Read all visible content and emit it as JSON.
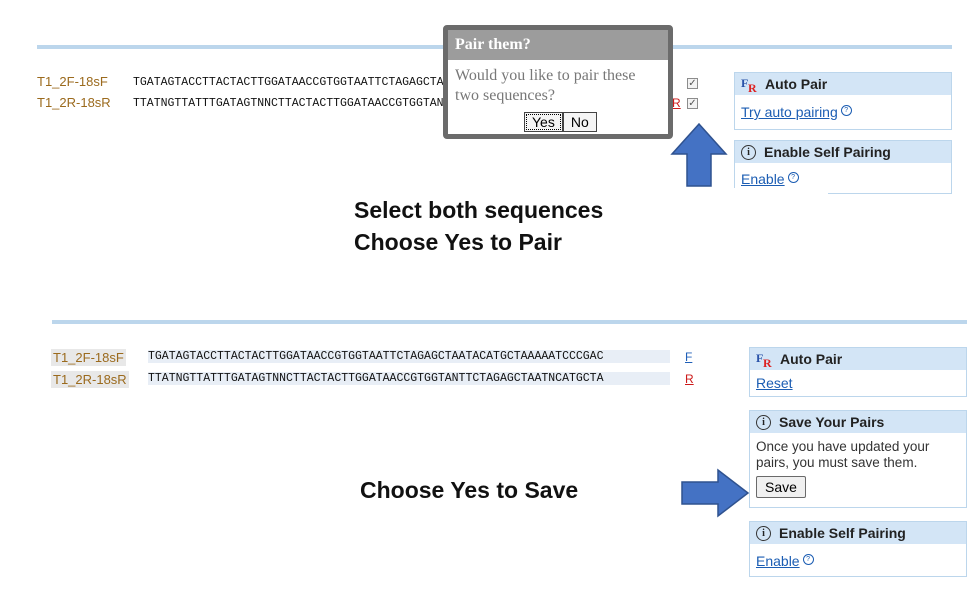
{
  "top": {
    "sequences": [
      {
        "name": "T1_2F-18sF",
        "seq": "TGATAGTACCTTACTACTTGGATAACCGTGGTAATTCTAGAGCTAATACATGCTAAAAATCCCGAC"
      },
      {
        "name": "T1_2R-18sR",
        "seq": "TTATNGTTATTTGATAGTNNCTTACTACTTGGATAACCGTGGTANTTCTAGAGCTAATNCATGCTA"
      }
    ],
    "reverse_marker": "R",
    "dialog": {
      "title": "Pair them?",
      "message": "Would you like to pair these two sequences?",
      "yes": "Yes",
      "no": "No"
    },
    "auto_pair": {
      "title": "Auto Pair",
      "link": "Try auto pairing"
    },
    "self_pairing": {
      "title": "Enable Self Pairing",
      "link": "Enable"
    },
    "caption_line1": "Select both sequences",
    "caption_line2": "Choose Yes to Pair"
  },
  "bottom": {
    "sequences": [
      {
        "name": "T1_2F-18sF",
        "seq": "TGATAGTACCTTACTACTTGGATAACCGTGGTAATTCTAGAGCTAATACATGCTAAAAATCCCGAC",
        "marker": "F"
      },
      {
        "name": "T1_2R-18sR",
        "seq": "TTATNGTTATTTGATAGTNNCTTACTACTTGGATAACCGTGGTANTTCTAGAGCTAATNCATGCTA",
        "marker": "R"
      }
    ],
    "auto_pair": {
      "title": "Auto Pair",
      "link": "Reset"
    },
    "save_pairs": {
      "title": "Save Your Pairs",
      "text": "Once you have updated your pairs, you must save them.",
      "button": "Save"
    },
    "self_pairing": {
      "title": "Enable Self Pairing",
      "link": "Enable"
    },
    "caption": "Choose Yes to Save"
  },
  "colors": {
    "arrow": "#4472c4",
    "panel_header": "#d3e5f6",
    "divider": "#bcd6ec",
    "name": "#9b6a1d"
  }
}
